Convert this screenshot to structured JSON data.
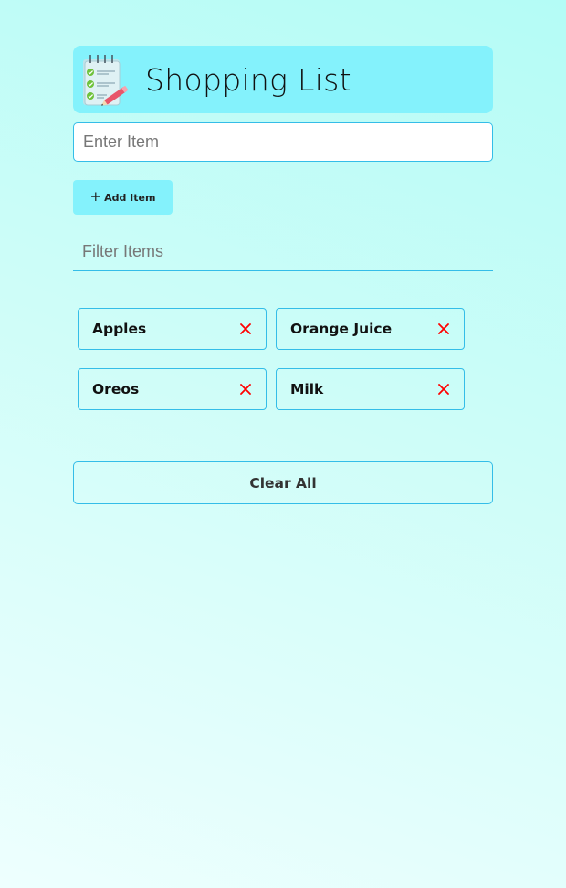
{
  "header": {
    "title": "Shopping List",
    "logo_icon": "checklist-notepad-icon"
  },
  "form": {
    "item_placeholder": "Enter Item",
    "item_value": "",
    "add_button_label": "Add Item",
    "add_button_icon": "plus-icon"
  },
  "filter": {
    "placeholder": "Filter Items",
    "value": ""
  },
  "items": [
    {
      "name": "Apples"
    },
    {
      "name": "Orange Juice"
    },
    {
      "name": "Oreos"
    },
    {
      "name": "Milk"
    }
  ],
  "clear_button_label": "Clear All",
  "colors": {
    "accent": "#84f2fc",
    "border": "#34bde8",
    "remove": "#ff0000"
  }
}
